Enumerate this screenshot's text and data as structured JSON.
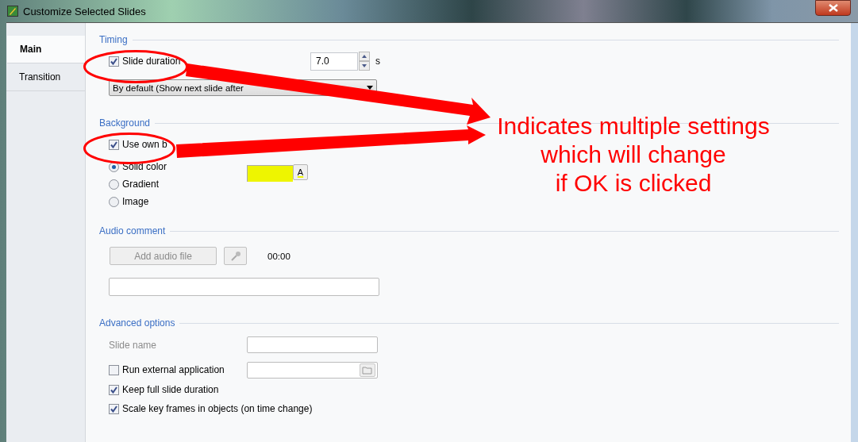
{
  "window": {
    "title": "Customize Selected Slides"
  },
  "tabs": [
    {
      "label": "Main",
      "selected": true
    },
    {
      "label": "Transition",
      "selected": false
    }
  ],
  "timing": {
    "title": "Timing",
    "slide_duration": {
      "label": "Slide duration",
      "checked": true
    },
    "duration_value": "7.0",
    "unit": "s",
    "mode_dropdown": "By default (Show next slide after"
  },
  "background": {
    "title": "Background",
    "use_own": {
      "label": "Use own b",
      "checked": true
    },
    "options": [
      {
        "label": "Solid color",
        "selected": true
      },
      {
        "label": "Gradient",
        "selected": false
      },
      {
        "label": "Image",
        "selected": false
      }
    ],
    "color": "#eef500",
    "color_button": "A"
  },
  "audio_comment": {
    "title": "Audio comment",
    "add_button": {
      "label": "Add audio file",
      "disabled": true
    },
    "time": "00:00"
  },
  "advanced_options": {
    "title": "Advanced options",
    "slide_name_label": "Slide name",
    "checkboxes": [
      {
        "label": "Run external application",
        "checked": false
      },
      {
        "label": "Keep full slide duration",
        "checked": true
      },
      {
        "label": "Scale key frames in objects (on time change)",
        "checked": true
      }
    ]
  },
  "annotation": {
    "lines": [
      "Indicates multiple settings",
      "which will change",
      "if OK is clicked"
    ]
  }
}
